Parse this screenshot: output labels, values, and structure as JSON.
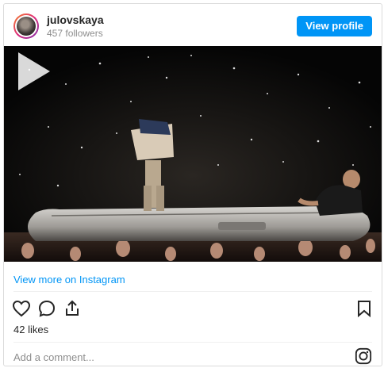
{
  "header": {
    "username": "julovskaya",
    "followers": "457 followers",
    "view_profile_label": "View profile"
  },
  "media": {
    "type": "video",
    "play_icon": "play-icon"
  },
  "links": {
    "view_more": "View more on Instagram"
  },
  "actions": {
    "icons": [
      "heart-icon",
      "comment-icon",
      "share-icon",
      "bookmark-icon"
    ]
  },
  "stats": {
    "likes": "42 likes"
  },
  "comment": {
    "placeholder": "Add a comment..."
  },
  "colors": {
    "accent": "#0095f6",
    "muted": "#8e8e8e",
    "border": "#dbdbdb"
  }
}
